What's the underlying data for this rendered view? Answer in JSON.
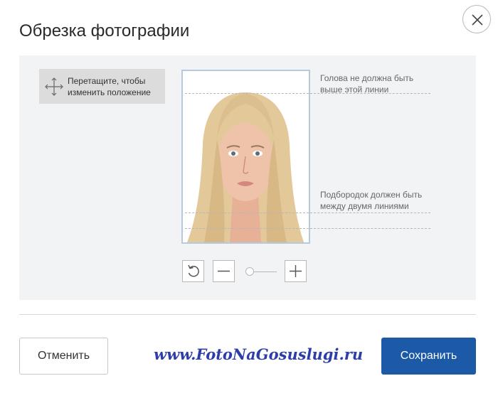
{
  "dialog": {
    "title": "Обрезка фотографии",
    "close_icon": "close-icon"
  },
  "editor": {
    "drag_hint": "Перетащите, чтобы изменить положение",
    "drag_icon": "move-arrows-icon",
    "head_line_note": "Голова не должна быть выше этой линии",
    "chin_lines_note": "Подбородок должен быть между двумя линиями",
    "photo_icon": "portrait-photo",
    "zoom_level": 0.1,
    "controls": {
      "rotate_icon": "rotate-icon",
      "zoom_out_icon": "minus-icon",
      "zoom_in_icon": "plus-icon"
    }
  },
  "footer": {
    "cancel_label": "Отменить",
    "save_label": "Сохранить",
    "watermark": "www.FotoNaGosuslugi.ru"
  },
  "colors": {
    "primary": "#1c5aa8",
    "watermark": "#2d3ea8",
    "work_area_bg": "#f2f3f4",
    "frame_border": "#b7c9dd"
  }
}
